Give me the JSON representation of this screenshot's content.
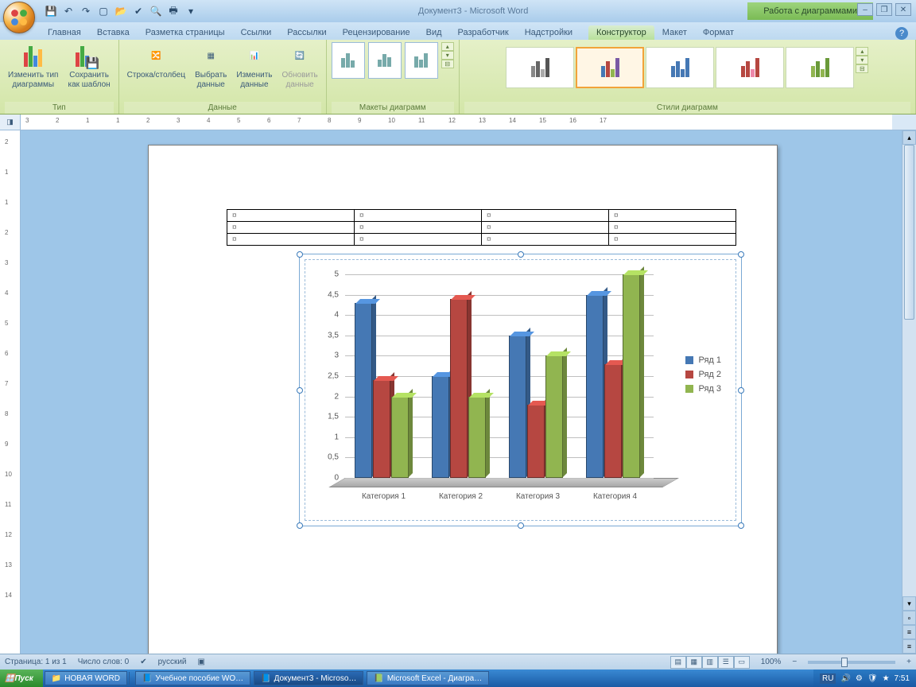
{
  "title": "Документ3 - Microsoft Word",
  "ctx_title": "Работа с диаграммами",
  "tabs": [
    "Главная",
    "Вставка",
    "Разметка страницы",
    "Ссылки",
    "Рассылки",
    "Рецензирование",
    "Вид",
    "Разработчик",
    "Надстройки"
  ],
  "ctx_tabs": [
    "Конструктор",
    "Макет",
    "Формат"
  ],
  "ribbon": {
    "type": {
      "label": "Тип",
      "change": "Изменить тип\nдиаграммы",
      "save": "Сохранить\nкак шаблон"
    },
    "data": {
      "label": "Данные",
      "swap": "Строка/столбец",
      "select": "Выбрать\nданные",
      "edit": "Изменить\nданные",
      "refresh": "Обновить\nданные"
    },
    "layouts": {
      "label": "Макеты диаграмм"
    },
    "styles": {
      "label": "Стили диаграмм"
    }
  },
  "table_mark": "¤",
  "statusbar": {
    "page": "Страница: 1 из 1",
    "words": "Число слов: 0",
    "lang": "русский",
    "zoom": "100%"
  },
  "taskbar": {
    "start": "Пуск",
    "folder": "НОВАЯ WORD",
    "t1": "Учебное пособие WO…",
    "t2": "Документ3 - Microso…",
    "t3": "Microsoft Excel - Диагра…",
    "lang": "RU",
    "time": "7:51"
  },
  "legend": [
    "Ряд 1",
    "Ряд 2",
    "Ряд 3"
  ],
  "chart_data": {
    "type": "bar",
    "categories": [
      "Категория 1",
      "Категория 2",
      "Категория 3",
      "Категория 4"
    ],
    "series": [
      {
        "name": "Ряд 1",
        "values": [
          4.3,
          2.5,
          3.5,
          4.5
        ],
        "color": "#4578b4"
      },
      {
        "name": "Ряд 2",
        "values": [
          2.4,
          4.4,
          1.8,
          2.8
        ],
        "color": "#b64741"
      },
      {
        "name": "Ряд 3",
        "values": [
          2.0,
          2.0,
          3.0,
          5.0
        ],
        "color": "#91b550"
      }
    ],
    "y_ticks": [
      0,
      0.5,
      1,
      1.5,
      2,
      2.5,
      3,
      3.5,
      4,
      4.5,
      5
    ],
    "ylim": [
      0,
      5
    ],
    "xlabel": "",
    "ylabel": "",
    "title": ""
  },
  "h_ruler": [
    -3,
    -2,
    -1,
    1,
    2,
    3,
    4,
    5,
    6,
    7,
    8,
    9,
    10,
    11,
    12,
    13,
    14,
    15,
    16,
    17
  ],
  "v_ruler": [
    2,
    1,
    1,
    2,
    3,
    4,
    5,
    6,
    7,
    8,
    9,
    10,
    11,
    12,
    13,
    14
  ]
}
